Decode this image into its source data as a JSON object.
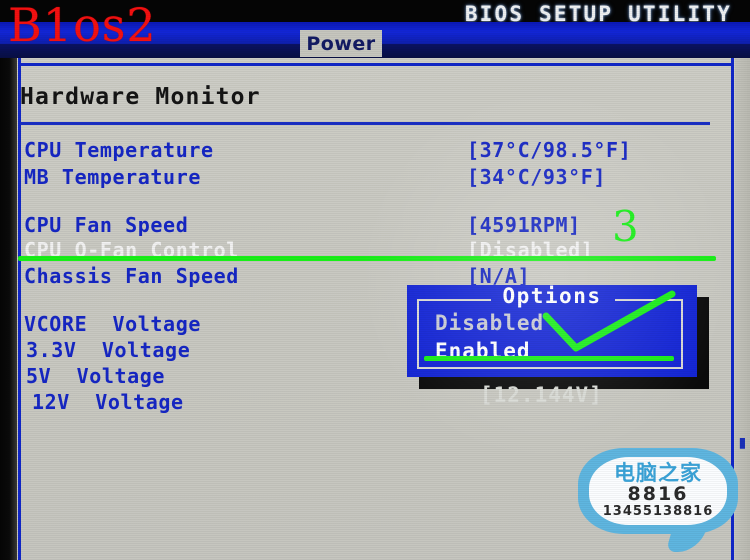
{
  "header": {
    "title": "BIOS SETUP UTILITY",
    "active_tab": "Power"
  },
  "main": {
    "section_title": "Hardware Monitor",
    "rows": [
      {
        "label": "CPU Temperature",
        "value": "[37°C/98.5°F]",
        "selected": false
      },
      {
        "label": "MB Temperature",
        "value": "[34°C/93°F]",
        "selected": false
      },
      {
        "label": "CPU Fan Speed",
        "value": "[4591RPM]",
        "selected": false
      },
      {
        "label": "CPU Q-Fan Control",
        "value": "[Disabled]",
        "selected": true
      },
      {
        "label": "Chassis Fan Speed",
        "value": "[N/A]",
        "selected": false
      },
      {
        "label": "VCORE  Voltage",
        "value": "",
        "selected": false
      },
      {
        "label": "3.3V  Voltage",
        "value": "",
        "selected": false
      },
      {
        "label": "5V  Voltage",
        "value": "",
        "selected": false
      },
      {
        "label": "12V  Voltage",
        "value": "",
        "selected": false
      }
    ],
    "occluded_value": "[12.144V]"
  },
  "popup": {
    "title": "Options",
    "options": [
      {
        "label": "Disabled",
        "selected": false
      },
      {
        "label": "Enabled",
        "selected": true
      }
    ]
  },
  "annotations": {
    "corner_label": "B1os2",
    "step_number": "3",
    "accent_color": "#18f018",
    "corner_color": "#f41010"
  },
  "watermark": {
    "shop_name": "电脑之家",
    "number": "8816",
    "phone": "13455138816"
  },
  "right_panel_ghost": "▮▮▮"
}
